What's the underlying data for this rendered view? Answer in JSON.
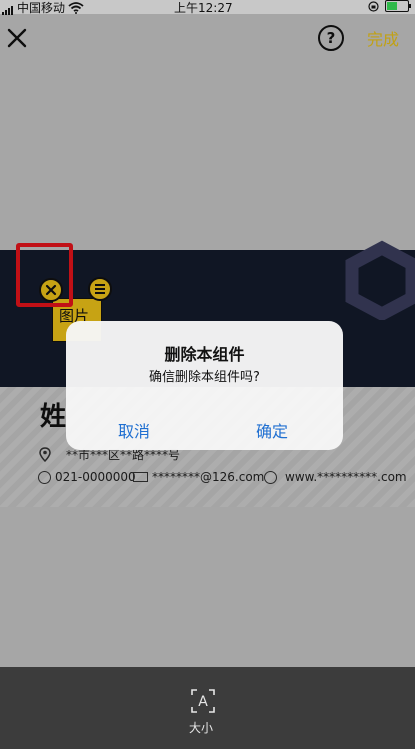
{
  "status_bar": {
    "carrier": "中国移动",
    "time": "上午12:27"
  },
  "toolbar": {
    "help_label": "?",
    "done_label": "完成",
    "accent_color": "#e8c21a"
  },
  "card": {
    "name": "姓",
    "address": "**市***区**路****号",
    "phone": "021-0000000",
    "email": "********@126.com",
    "website": "www.**********.com",
    "logo_label": "图片",
    "band_color": "#141b2c",
    "widget_color": "#f0c419"
  },
  "dialog": {
    "title": "删除本组件",
    "message": "确信删除本组件吗?",
    "cancel_label": "取消",
    "confirm_label": "确定",
    "button_color": "#1f6fd1"
  },
  "highlight_color": "#e8141b",
  "bottom_bar": {
    "size_label": "大小",
    "size_icon_glyph": "A"
  }
}
